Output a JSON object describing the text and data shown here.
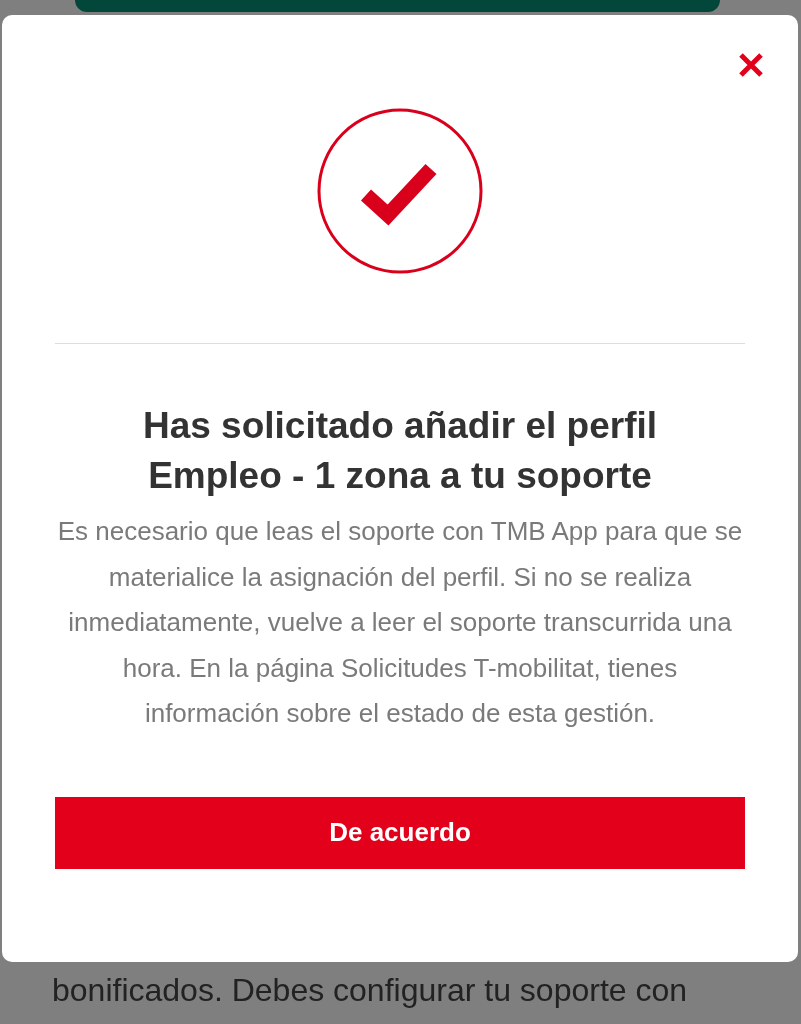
{
  "dialog": {
    "title": "Has solicitado añadir el perfil Empleo - 1 zona a tu soporte",
    "message": "Es necesario que leas el soporte con TMB App para que se materialice la asignación del perfil. Si no se realiza inmediatamente, vuelve a leer el soporte transcurrida una hora. En la página Solicitudes T-mobilitat, tienes información sobre el estado de esta gestión.",
    "button": "De acuerdo"
  },
  "background_text": "bonificados. Debes configurar tu soporte con"
}
